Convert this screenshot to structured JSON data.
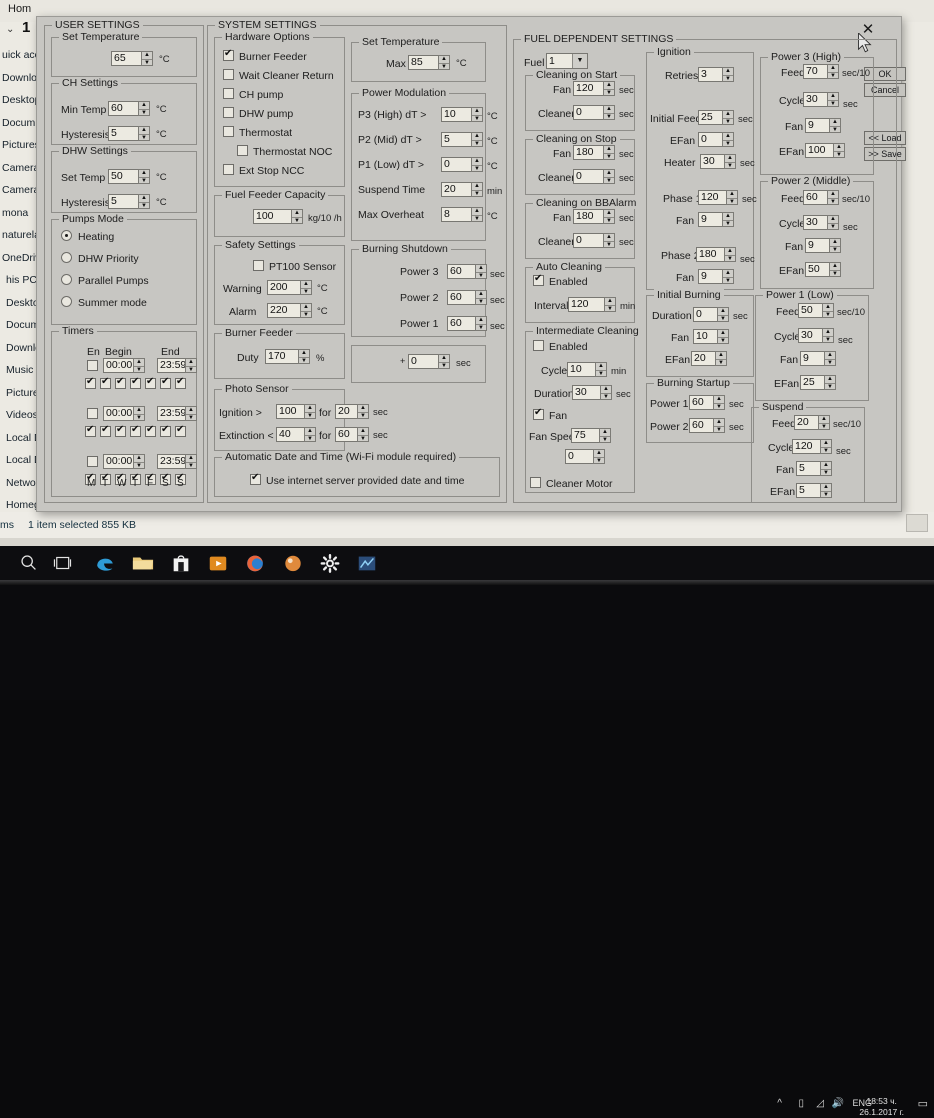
{
  "explorer": {
    "home_tab": "Hom",
    "ribbon_num": "1",
    "nav_items": [
      "uick acc",
      "Downlo",
      "Desktop",
      "Docum",
      "Pictures",
      "Camera",
      "Camera",
      "mona",
      "naturela",
      "OneDrive",
      "his PC",
      "Desktop",
      "Docum",
      "Downlo",
      "Music",
      "Pictures",
      "Videos",
      "Local Di",
      "Local Di",
      "Network",
      "Homegro"
    ],
    "status_left": "ms",
    "status_text": "1 item selected  855 KB"
  },
  "dialog": {
    "close_label": "✕",
    "buttons": {
      "ok": "OK",
      "cancel": "Cancel",
      "load": "<< Load",
      "save": ">> Save"
    }
  },
  "user_settings": {
    "caption": "USER SETTINGS",
    "set_temperature": {
      "caption": "Set Temperature",
      "value": "65",
      "unit": "°C"
    },
    "ch_settings": {
      "caption": "CH Settings",
      "min_temp_label": "Min Temp",
      "min_temp_value": "60",
      "min_temp_unit": "°C",
      "hysteresis_label": "Hysteresis",
      "hysteresis_value": "5",
      "hysteresis_unit": "°C"
    },
    "dhw_settings": {
      "caption": "DHW Settings",
      "set_temp_label": "Set Temp",
      "set_temp_value": "50",
      "set_temp_unit": "°C",
      "hysteresis_label": "Hysteresis",
      "hysteresis_value": "5",
      "hysteresis_unit": "°C"
    },
    "pumps_mode": {
      "caption": "Pumps Mode",
      "options": [
        "Heating",
        "DHW Priority",
        "Parallel Pumps",
        "Summer mode"
      ],
      "selected": "Heating"
    },
    "timers": {
      "caption": "Timers",
      "col_en": "En",
      "col_begin": "Begin",
      "col_end": "End",
      "rows": [
        {
          "enabled": false,
          "begin": "00:00",
          "end": "23:59",
          "days": [
            true,
            true,
            true,
            true,
            true,
            true,
            true
          ]
        },
        {
          "enabled": false,
          "begin": "00:00",
          "end": "23:59",
          "days": [
            true,
            true,
            true,
            true,
            true,
            true,
            true
          ]
        },
        {
          "enabled": false,
          "begin": "00:00",
          "end": "23:59",
          "days": [
            true,
            true,
            true,
            true,
            true,
            true,
            true
          ]
        }
      ],
      "day_labels": [
        "M",
        "T",
        "W",
        "T",
        "F",
        "S",
        "S"
      ]
    }
  },
  "system_settings": {
    "caption": "SYSTEM SETTINGS",
    "hardware_options": {
      "caption": "Hardware Options",
      "items": [
        {
          "label": "Burner Feeder",
          "checked": true
        },
        {
          "label": "Wait Cleaner Return",
          "checked": false
        },
        {
          "label": "CH pump",
          "checked": false
        },
        {
          "label": "DHW pump",
          "checked": false
        },
        {
          "label": "Thermostat",
          "checked": false
        },
        {
          "label": "Thermostat NOC",
          "checked": false
        },
        {
          "label": "Ext Stop NCC",
          "checked": false
        }
      ]
    },
    "fuel_feeder_capacity": {
      "caption": "Fuel Feeder Capacity",
      "value": "100",
      "unit": "kg/10 /h"
    },
    "safety_settings": {
      "caption": "Safety Settings",
      "pt100_label": "PT100 Sensor",
      "pt100_checked": false,
      "warning_label": "Warning",
      "warning_value": "200",
      "warning_unit": "°C",
      "alarm_label": "Alarm",
      "alarm_value": "220",
      "alarm_unit": "°C"
    },
    "burner_feeder": {
      "caption": "Burner Feeder",
      "duty_label": "Duty",
      "duty_value": "170",
      "duty_unit": "%"
    },
    "photo_sensor": {
      "caption": "Photo Sensor",
      "ignition_label": "Ignition  >",
      "ignition_value": "100",
      "ignition_for": "for",
      "ignition_time": "20",
      "ignition_unit": "sec",
      "extinction_label": "Extinction  <",
      "extinction_value": "40",
      "extinction_for": "for",
      "extinction_time": "60",
      "extinction_unit": "sec"
    },
    "auto_datetime": {
      "caption": "Automatic Date and Time (Wi-Fi module required)",
      "use_label": "Use internet server provided date and time",
      "checked": true
    },
    "set_temperature": {
      "caption": "Set Temperature",
      "max_label": "Max",
      "max_value": "85",
      "unit": "°C"
    },
    "power_modulation": {
      "caption": "Power Modulation",
      "rows": [
        {
          "label": "P3 (High)  dT >",
          "value": "10",
          "unit": "°C"
        },
        {
          "label": "P2 (Mid)   dT >",
          "value": "5",
          "unit": "°C"
        },
        {
          "label": "P1 (Low)   dT >",
          "value": "0",
          "unit": "°C"
        },
        {
          "label": "Suspend Time",
          "value": "20",
          "unit": "min"
        },
        {
          "label": "Max Overheat",
          "value": "8",
          "unit": "°C"
        }
      ]
    },
    "burning_shutdown": {
      "caption": "Burning Shutdown",
      "rows": [
        {
          "label": "Power 3",
          "value": "60",
          "unit": "sec"
        },
        {
          "label": "Power 2",
          "value": "60",
          "unit": "sec"
        },
        {
          "label": "Power 1",
          "value": "60",
          "unit": "sec"
        }
      ]
    },
    "extra_delay": {
      "prefix": "+",
      "value": "0",
      "unit": "sec"
    }
  },
  "fuel_settings": {
    "caption": "FUEL DEPENDENT SETTINGS",
    "fuel_label": "Fuel",
    "fuel_value": "1",
    "cleaning_on_start": {
      "caption": "Cleaning on Start",
      "fan_label": "Fan",
      "fan_value": "120",
      "fan_unit": "sec",
      "cleaner_label": "Cleaner",
      "cleaner_value": "0",
      "cleaner_unit": "sec"
    },
    "cleaning_on_stop": {
      "caption": "Cleaning on Stop",
      "fan_label": "Fan",
      "fan_value": "180",
      "fan_unit": "sec",
      "cleaner_label": "Cleaner",
      "cleaner_value": "0",
      "cleaner_unit": "sec"
    },
    "cleaning_on_bbalarm": {
      "caption": "Cleaning  on BBAlarm",
      "fan_label": "Fan",
      "fan_value": "180",
      "fan_unit": "sec",
      "cleaner_label": "Cleaner",
      "cleaner_value": "0",
      "cleaner_unit": "sec"
    },
    "auto_cleaning": {
      "caption": "Auto Cleaning",
      "enabled_label": "Enabled",
      "enabled": true,
      "interval_label": "Interval",
      "interval_value": "120",
      "interval_unit": "min"
    },
    "intermediate_cleaning": {
      "caption": "Intermediate Cleaning",
      "enabled_label": "Enabled",
      "enabled": false,
      "cycle_label": "Cycle",
      "cycle_value": "10",
      "cycle_unit": "min",
      "duration_label": "Duration",
      "duration_value": "30",
      "duration_unit": "sec",
      "fan_label": "Fan",
      "fan_checked": true,
      "fan_speed_label": "Fan Speed",
      "fan_speed_value": "75",
      "extra_value": "0",
      "cleaner_motor_label": "Cleaner Motor",
      "cleaner_motor_checked": false
    },
    "ignition": {
      "caption": "Ignition",
      "retries_label": "Retries",
      "retries_value": "3",
      "initial_feed_label": "Initial Feed",
      "initial_feed_value": "25",
      "initial_feed_unit": "sec",
      "efan_label": "EFan",
      "efan_value": "0",
      "heater_label": "Heater",
      "heater_value": "30",
      "heater_unit": "sec",
      "phase1_label": "Phase 1",
      "phase1_value": "120",
      "phase1_unit": "sec",
      "phase1_fan_label": "Fan",
      "phase1_fan_value": "9",
      "phase2_label": "Phase 2",
      "phase2_value": "180",
      "phase2_unit": "sec",
      "phase2_fan_label": "Fan",
      "phase2_fan_value": "9"
    },
    "initial_burning": {
      "caption": "Initial Burning",
      "duration_label": "Duration",
      "duration_value": "0",
      "duration_unit": "sec",
      "fan_label": "Fan",
      "fan_value": "10",
      "efan_label": "EFan",
      "efan_value": "20"
    },
    "burning_startup": {
      "caption": "Burning Startup",
      "power1_label": "Power 1",
      "power1_value": "60",
      "power1_unit": "sec",
      "power2_label": "Power 2",
      "power2_value": "60",
      "power2_unit": "sec"
    },
    "power3": {
      "caption": "Power 3 (High)",
      "feed_label": "Feed",
      "feed_value": "70",
      "feed_unit": "sec/10",
      "cycle_label": "Cycle",
      "cycle_value": "30",
      "cycle_unit": "sec",
      "fan_label": "Fan",
      "fan_value": "9",
      "efan_label": "EFan",
      "efan_value": "100"
    },
    "power2": {
      "caption": "Power 2 (Middle)",
      "feed_label": "Feed",
      "feed_value": "60",
      "feed_unit": "sec/10",
      "cycle_label": "Cycle",
      "cycle_value": "30",
      "cycle_unit": "sec",
      "fan_label": "Fan",
      "fan_value": "9",
      "efan_label": "EFan",
      "efan_value": "50"
    },
    "power1": {
      "caption": "Power 1 (Low)",
      "feed_label": "Feed",
      "feed_value": "50",
      "feed_unit": "sec/10",
      "cycle_label": "Cycle",
      "cycle_value": "30",
      "cycle_unit": "sec",
      "fan_label": "Fan",
      "fan_value": "9",
      "efan_label": "EFan",
      "efan_value": "25"
    },
    "suspend": {
      "caption": "Suspend",
      "feed_label": "Feed",
      "feed_value": "20",
      "feed_unit": "sec/10",
      "cycle_label": "Cycle",
      "cycle_value": "120",
      "cycle_unit": "sec",
      "fan_label": "Fan",
      "fan_value": "5",
      "efan_label": "EFan",
      "efan_value": "5"
    }
  },
  "taskbar": {
    "icons": [
      "search-icon",
      "task-view-icon",
      "edge-icon",
      "file-explorer-icon",
      "store-icon",
      "media-icon",
      "firefox-icon",
      "app-orange-icon",
      "settings-icon",
      "chart-app-icon"
    ],
    "tray": {
      "lang": "ENG",
      "time": "18:53 ч.",
      "date": "26.1.2017 г."
    }
  }
}
